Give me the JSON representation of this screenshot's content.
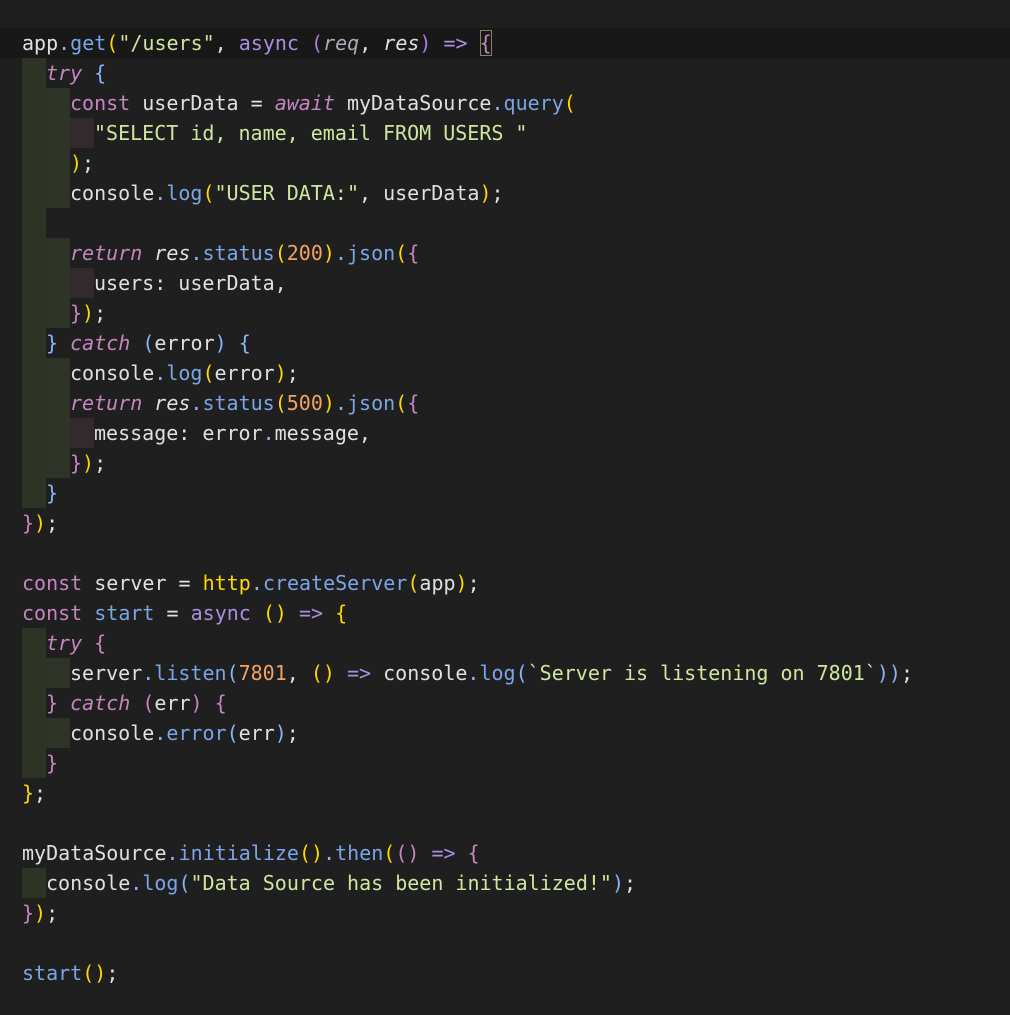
{
  "editor": {
    "theme": {
      "background": "#1f1f1f",
      "current_line": "#181818",
      "colors": {
        "t": "#e0e0e0",
        "p": "#c586c0",
        "b": "#89b4fa",
        "s": "#cfe6a0",
        "n": "#f4a261",
        "y": "#ffd700",
        "m": "#b07ae0",
        "g": "#a6acb9",
        "v": "#c0c0c0",
        "f": "#7aa5e6",
        "k": "#aa8fe0",
        "c": "#4fa8e8"
      },
      "guide_colors": {
        "g1": "#2d3325",
        "g2": "#2f3429",
        "g3": "#332a2e",
        "g4": "#2c2b2f",
        "g5": "#2a2d38"
      }
    },
    "lines": [
      {
        "guides": [],
        "bracket": true,
        "tokens": [
          [
            "app",
            "t",
            false
          ],
          [
            ".",
            "b",
            false
          ],
          [
            "get",
            "f",
            false
          ],
          [
            "(",
            "y",
            false
          ],
          [
            "\"/users\"",
            "s",
            false
          ],
          [
            ", ",
            "t",
            false
          ],
          [
            "async",
            "k",
            false
          ],
          [
            " ",
            "t",
            false
          ],
          [
            "(",
            "m",
            false
          ],
          [
            "req",
            "g",
            true
          ],
          [
            ", ",
            "t",
            false
          ],
          [
            "res",
            "t",
            true
          ],
          [
            ")",
            "m",
            false
          ],
          [
            " => ",
            "k",
            false
          ]
        ],
        "tail": "{"
      },
      {
        "guides": [
          "g1"
        ],
        "tokens": [
          [
            "try",
            "p",
            true
          ],
          [
            " ",
            "t",
            false
          ],
          [
            "{",
            "b",
            false
          ]
        ]
      },
      {
        "guides": [
          "g1",
          "g2"
        ],
        "tokens": [
          [
            "const",
            "p",
            false
          ],
          [
            " userData = ",
            "t",
            false
          ],
          [
            "await",
            "p",
            true
          ],
          [
            " myDataSource",
            "t",
            false
          ],
          [
            ".",
            "b",
            false
          ],
          [
            "query",
            "f",
            false
          ],
          [
            "(",
            "y",
            false
          ]
        ]
      },
      {
        "guides": [
          "g1",
          "g2",
          "g3"
        ],
        "tokens": [
          [
            "\"SELECT id, name, email FROM USERS \"",
            "s",
            false
          ]
        ]
      },
      {
        "guides": [
          "g1",
          "g2"
        ],
        "tokens": [
          [
            ")",
            "y",
            false
          ],
          [
            ";",
            "t",
            false
          ]
        ]
      },
      {
        "guides": [
          "g1",
          "g2"
        ],
        "tokens": [
          [
            "console",
            "t",
            false
          ],
          [
            ".",
            "b",
            false
          ],
          [
            "log",
            "f",
            false
          ],
          [
            "(",
            "y",
            false
          ],
          [
            "\"USER DATA:\"",
            "s",
            false
          ],
          [
            ", userData",
            "t",
            false
          ],
          [
            ")",
            "y",
            false
          ],
          [
            ";",
            "t",
            false
          ]
        ]
      },
      {
        "guides": [
          "g1"
        ],
        "tokens": []
      },
      {
        "guides": [
          "g1",
          "g2"
        ],
        "tokens": [
          [
            "return",
            "p",
            true
          ],
          [
            " ",
            "t",
            false
          ],
          [
            "res",
            "t",
            true
          ],
          [
            ".",
            "b",
            false
          ],
          [
            "status",
            "f",
            false
          ],
          [
            "(",
            "y",
            false
          ],
          [
            "200",
            "n",
            false
          ],
          [
            ")",
            "y",
            false
          ],
          [
            ".",
            "b",
            false
          ],
          [
            "json",
            "f",
            false
          ],
          [
            "(",
            "y",
            false
          ],
          [
            "{",
            "p",
            false
          ]
        ]
      },
      {
        "guides": [
          "g1",
          "g2",
          "g3"
        ],
        "tokens": [
          [
            "users: userData,",
            "t",
            false
          ]
        ]
      },
      {
        "guides": [
          "g1",
          "g2"
        ],
        "tokens": [
          [
            "}",
            "p",
            false
          ],
          [
            ")",
            "y",
            false
          ],
          [
            ";",
            "t",
            false
          ]
        ]
      },
      {
        "guides": [
          "g1"
        ],
        "tokens": [
          [
            "}",
            "b",
            false
          ],
          [
            " ",
            "t",
            false
          ],
          [
            "catch",
            "p",
            true
          ],
          [
            " ",
            "t",
            false
          ],
          [
            "(",
            "b",
            false
          ],
          [
            "error",
            "t",
            false
          ],
          [
            ")",
            "b",
            false
          ],
          [
            " ",
            "t",
            false
          ],
          [
            "{",
            "b",
            false
          ]
        ]
      },
      {
        "guides": [
          "g1",
          "g2"
        ],
        "tokens": [
          [
            "console",
            "t",
            false
          ],
          [
            ".",
            "b",
            false
          ],
          [
            "log",
            "f",
            false
          ],
          [
            "(",
            "y",
            false
          ],
          [
            "error",
            "t",
            false
          ],
          [
            ")",
            "y",
            false
          ],
          [
            ";",
            "t",
            false
          ]
        ]
      },
      {
        "guides": [
          "g1",
          "g2"
        ],
        "tokens": [
          [
            "return",
            "p",
            true
          ],
          [
            " ",
            "t",
            false
          ],
          [
            "res",
            "t",
            true
          ],
          [
            ".",
            "b",
            false
          ],
          [
            "status",
            "f",
            false
          ],
          [
            "(",
            "y",
            false
          ],
          [
            "500",
            "n",
            false
          ],
          [
            ")",
            "y",
            false
          ],
          [
            ".",
            "b",
            false
          ],
          [
            "json",
            "f",
            false
          ],
          [
            "(",
            "y",
            false
          ],
          [
            "{",
            "p",
            false
          ]
        ]
      },
      {
        "guides": [
          "g1",
          "g2",
          "g3"
        ],
        "tokens": [
          [
            "message: error",
            "t",
            false
          ],
          [
            ".",
            "b",
            false
          ],
          [
            "message,",
            "t",
            false
          ]
        ]
      },
      {
        "guides": [
          "g1",
          "g2"
        ],
        "tokens": [
          [
            "}",
            "p",
            false
          ],
          [
            ")",
            "y",
            false
          ],
          [
            ";",
            "t",
            false
          ]
        ]
      },
      {
        "guides": [
          "g1"
        ],
        "tokens": [
          [
            "}",
            "b",
            false
          ]
        ]
      },
      {
        "guides": [],
        "tokens": [
          [
            "}",
            "p",
            false
          ],
          [
            ")",
            "y",
            false
          ],
          [
            ";",
            "t",
            false
          ]
        ]
      },
      {
        "guides": [],
        "tokens": []
      },
      {
        "guides": [],
        "tokens": [
          [
            "const",
            "p",
            false
          ],
          [
            " server = ",
            "t",
            false
          ],
          [
            "http",
            "y",
            false
          ],
          [
            ".",
            "b",
            false
          ],
          [
            "createServer",
            "f",
            false
          ],
          [
            "(",
            "y",
            false
          ],
          [
            "app",
            "t",
            false
          ],
          [
            ")",
            "y",
            false
          ],
          [
            ";",
            "t",
            false
          ]
        ]
      },
      {
        "guides": [],
        "tokens": [
          [
            "const",
            "p",
            false
          ],
          [
            " ",
            "t",
            false
          ],
          [
            "start",
            "f",
            false
          ],
          [
            " = ",
            "t",
            false
          ],
          [
            "async",
            "k",
            false
          ],
          [
            " ",
            "t",
            false
          ],
          [
            "()",
            "y",
            false
          ],
          [
            " => ",
            "k",
            false
          ],
          [
            "{",
            "y",
            false
          ]
        ]
      },
      {
        "guides": [
          "g1"
        ],
        "tokens": [
          [
            "try",
            "p",
            true
          ],
          [
            " ",
            "t",
            false
          ],
          [
            "{",
            "p",
            false
          ]
        ]
      },
      {
        "guides": [
          "g1",
          "g2"
        ],
        "tokens": [
          [
            "server",
            "t",
            false
          ],
          [
            ".",
            "b",
            false
          ],
          [
            "listen",
            "f",
            false
          ],
          [
            "(",
            "b",
            false
          ],
          [
            "7801",
            "n",
            false
          ],
          [
            ", ",
            "t",
            false
          ],
          [
            "()",
            "y",
            false
          ],
          [
            " => ",
            "k",
            false
          ],
          [
            "console",
            "t",
            false
          ],
          [
            ".",
            "b",
            false
          ],
          [
            "log",
            "f",
            false
          ],
          [
            "(",
            "b",
            false
          ],
          [
            "`Server is listening on 7801`",
            "s",
            false
          ],
          [
            ")",
            "b",
            false
          ],
          [
            ")",
            "b",
            false
          ],
          [
            ";",
            "t",
            false
          ]
        ]
      },
      {
        "guides": [
          "g1"
        ],
        "tokens": [
          [
            "}",
            "p",
            false
          ],
          [
            " ",
            "t",
            false
          ],
          [
            "catch",
            "p",
            true
          ],
          [
            " ",
            "t",
            false
          ],
          [
            "(",
            "p",
            false
          ],
          [
            "err",
            "t",
            false
          ],
          [
            ")",
            "p",
            false
          ],
          [
            " ",
            "t",
            false
          ],
          [
            "{",
            "p",
            false
          ]
        ]
      },
      {
        "guides": [
          "g1",
          "g2"
        ],
        "tokens": [
          [
            "console",
            "t",
            false
          ],
          [
            ".",
            "b",
            false
          ],
          [
            "error",
            "f",
            false
          ],
          [
            "(",
            "b",
            false
          ],
          [
            "err",
            "t",
            false
          ],
          [
            ")",
            "b",
            false
          ],
          [
            ";",
            "t",
            false
          ]
        ]
      },
      {
        "guides": [
          "g1"
        ],
        "tokens": [
          [
            "}",
            "p",
            false
          ]
        ]
      },
      {
        "guides": [],
        "tokens": [
          [
            "}",
            "y",
            false
          ],
          [
            ";",
            "t",
            false
          ]
        ]
      },
      {
        "guides": [],
        "tokens": []
      },
      {
        "guides": [],
        "tokens": [
          [
            "myDataSource",
            "t",
            false
          ],
          [
            ".",
            "b",
            false
          ],
          [
            "initialize",
            "f",
            false
          ],
          [
            "()",
            "y",
            false
          ],
          [
            ".",
            "b",
            false
          ],
          [
            "then",
            "f",
            false
          ],
          [
            "(",
            "y",
            false
          ],
          [
            "()",
            "p",
            false
          ],
          [
            " => ",
            "k",
            false
          ],
          [
            "{",
            "p",
            false
          ]
        ]
      },
      {
        "guides": [
          "g1"
        ],
        "tokens": [
          [
            "console",
            "t",
            false
          ],
          [
            ".",
            "b",
            false
          ],
          [
            "log",
            "f",
            false
          ],
          [
            "(",
            "b",
            false
          ],
          [
            "\"Data Source has been initialized!\"",
            "s",
            false
          ],
          [
            ")",
            "b",
            false
          ],
          [
            ";",
            "t",
            false
          ]
        ]
      },
      {
        "guides": [],
        "tokens": [
          [
            "}",
            "p",
            false
          ],
          [
            ")",
            "y",
            false
          ],
          [
            ";",
            "t",
            false
          ]
        ]
      },
      {
        "guides": [],
        "tokens": []
      },
      {
        "guides": [],
        "tokens": [
          [
            "start",
            "f",
            false
          ],
          [
            "()",
            "y",
            false
          ],
          [
            ";",
            "t",
            false
          ]
        ]
      }
    ]
  }
}
